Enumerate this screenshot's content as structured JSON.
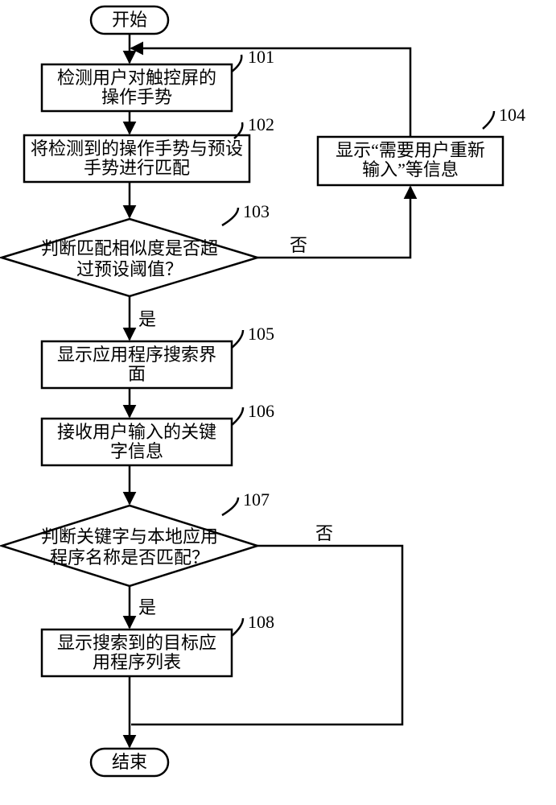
{
  "terminals": {
    "start": "开始",
    "end": "结束"
  },
  "steps": {
    "s101": {
      "num": "101",
      "line1": "检测用户对触控屏的",
      "line2": "操作手势"
    },
    "s102": {
      "num": "102",
      "line1": "将检测到的操作手势与预设",
      "line2": "手势进行匹配"
    },
    "s103": {
      "num": "103",
      "line1": "判断匹配相似度是否超",
      "line2": "过预设阈值？"
    },
    "s104": {
      "num": "104",
      "line1": "显示“需要用户重新",
      "line2": "输入”等信息"
    },
    "s105": {
      "num": "105",
      "line1": "显示应用程序搜索界",
      "line2": "面"
    },
    "s106": {
      "num": "106",
      "line1": "接收用户输入的关键",
      "line2": "字信息"
    },
    "s107": {
      "num": "107",
      "line1": "判断关键字与本地应用",
      "line2": "程序名称是否匹配？"
    },
    "s108": {
      "num": "108",
      "line1": "显示搜索到的目标应",
      "line2": "用程序列表"
    }
  },
  "edges": {
    "yes": "是",
    "no": "否"
  }
}
